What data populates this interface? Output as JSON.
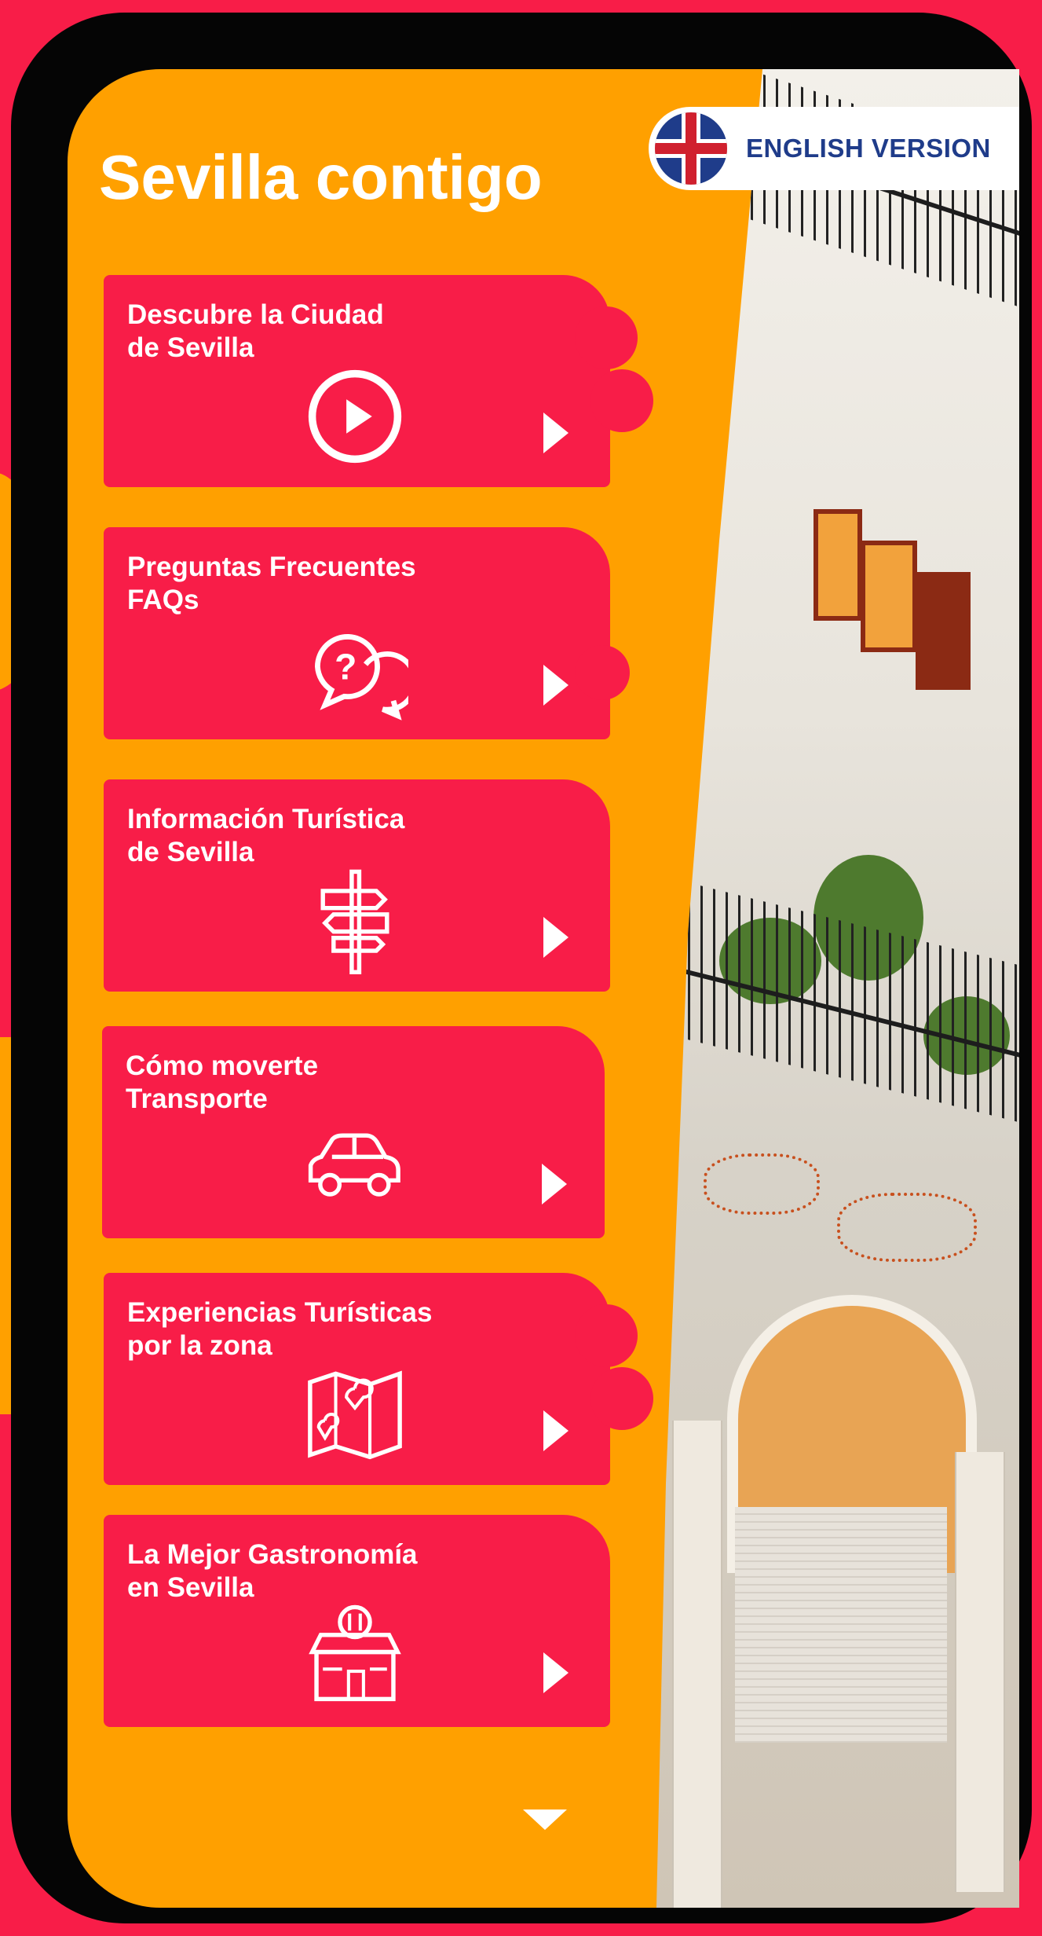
{
  "header": {
    "title": "Sevilla contigo",
    "language_button": {
      "label": "ENGLISH VERSION",
      "icon": "uk-flag-icon"
    }
  },
  "menu": {
    "items": [
      {
        "label": "Descubre la Ciudad\nde Sevilla",
        "icon": "play-circle-icon"
      },
      {
        "label": "Preguntas Frecuentes\nFAQs",
        "icon": "question-chat-icon"
      },
      {
        "label": "Información Turística\nde Sevilla",
        "icon": "signpost-icon"
      },
      {
        "label": "Cómo moverte\nTransporte",
        "icon": "car-icon"
      },
      {
        "label": "Experiencias Turísticas\npor la zona",
        "icon": "map-pin-icon"
      },
      {
        "label": "La Mejor Gastronomía\nen Sevilla",
        "icon": "restaurant-icon"
      }
    ],
    "item_arrow_icon": "chevron-right-icon"
  },
  "scroll_indicator": {
    "icon": "chevron-down-icon"
  },
  "colors": {
    "accent_red": "#F81D48",
    "panel_orange": "#FFA000",
    "frame": "#050505",
    "flag_blue": "#1F3C8A"
  }
}
